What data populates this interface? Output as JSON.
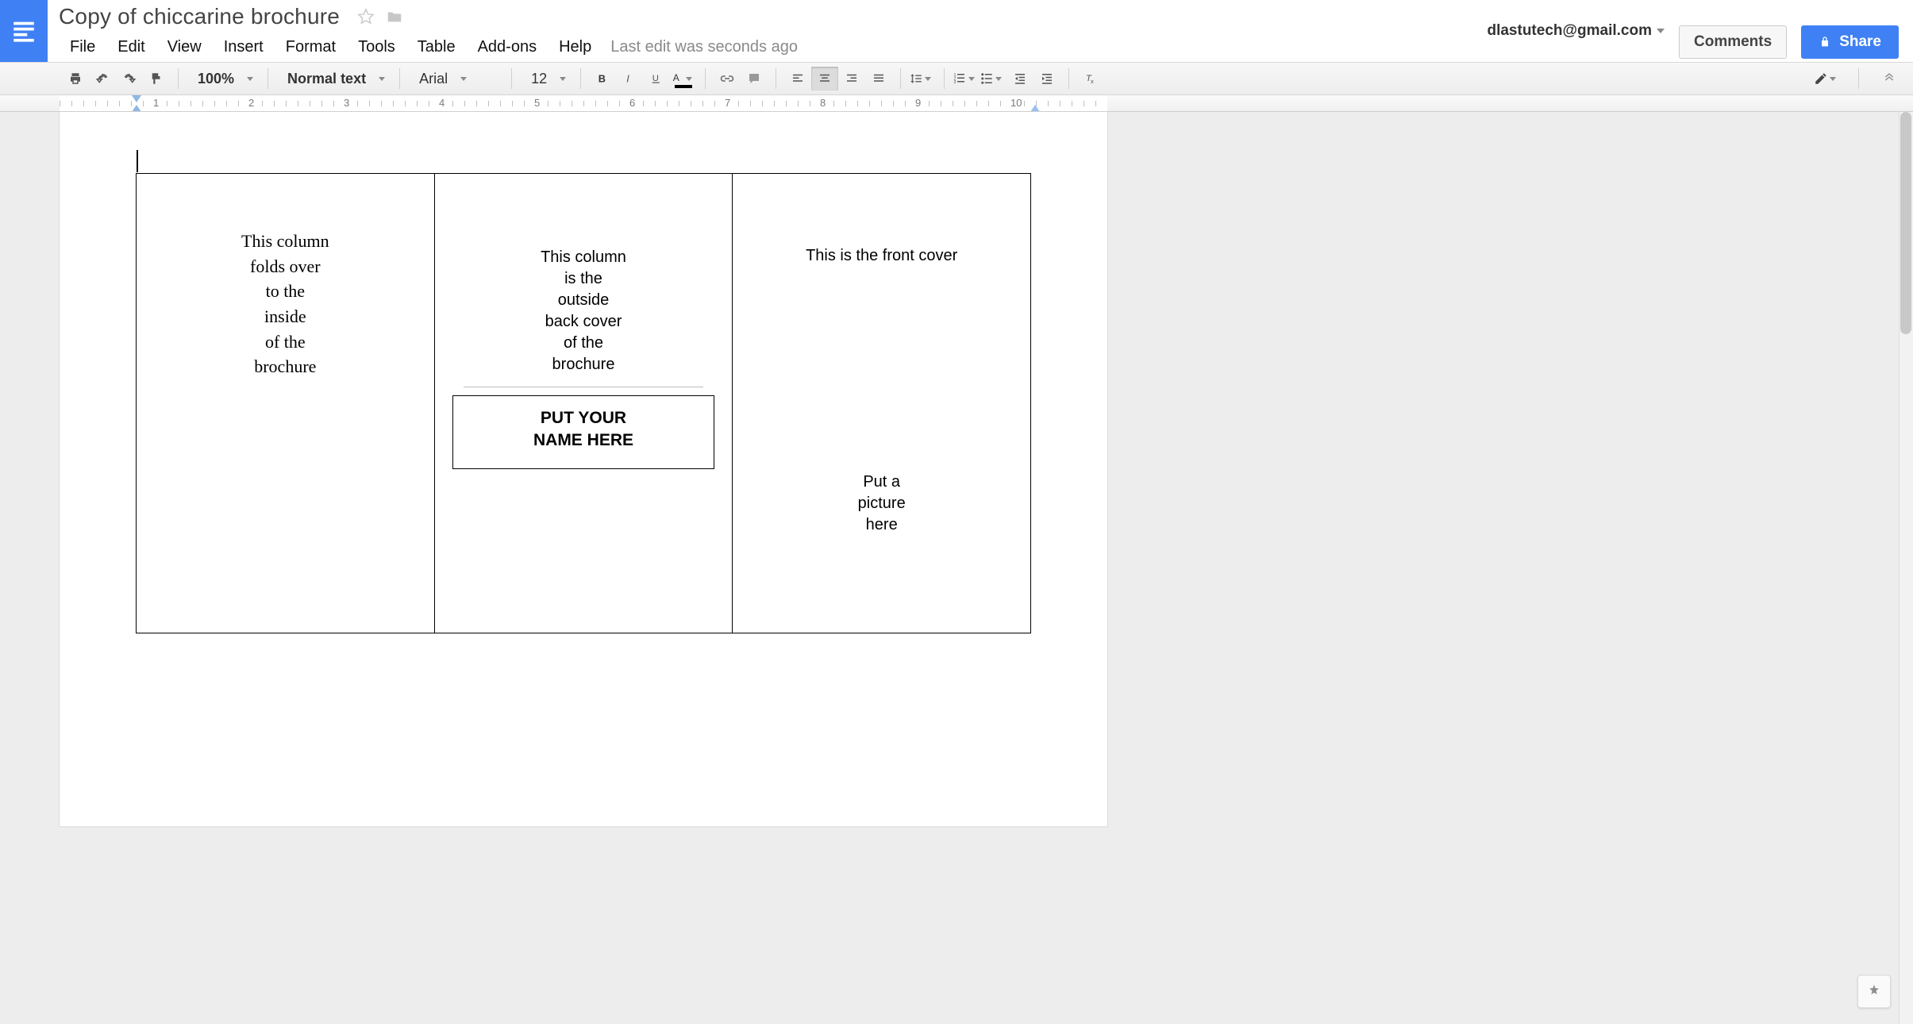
{
  "header": {
    "doc_title": "Copy of chiccarine brochure",
    "account_email": "dlastutech@gmail.com",
    "comments_label": "Comments",
    "share_label": "Share",
    "last_edit": "Last edit was seconds ago"
  },
  "menu": {
    "file": "File",
    "edit": "Edit",
    "view": "View",
    "insert": "Insert",
    "format": "Format",
    "tools": "Tools",
    "table": "Table",
    "addons": "Add-ons",
    "help": "Help"
  },
  "toolbar": {
    "zoom": "100%",
    "style": "Normal text",
    "font": "Arial",
    "font_size": "12"
  },
  "ruler": {
    "numbers": [
      "1",
      "2",
      "3",
      "4",
      "5",
      "6",
      "7",
      "8",
      "9",
      "10"
    ]
  },
  "document": {
    "col1": {
      "l1": "This column",
      "l2": "folds over",
      "l3": "to the",
      "l4": "inside",
      "l5": "of the",
      "l6": "brochure"
    },
    "col2": {
      "l1": "This column",
      "l2": "is the",
      "l3": "outside",
      "l4": "back cover",
      "l5": "of the",
      "l6": "brochure",
      "name_box_l1": "PUT YOUR",
      "name_box_l2": "NAME HERE"
    },
    "col3": {
      "front": "This is the front cover",
      "pic_l1": "Put a",
      "pic_l2": "picture",
      "pic_l3": "here"
    }
  }
}
